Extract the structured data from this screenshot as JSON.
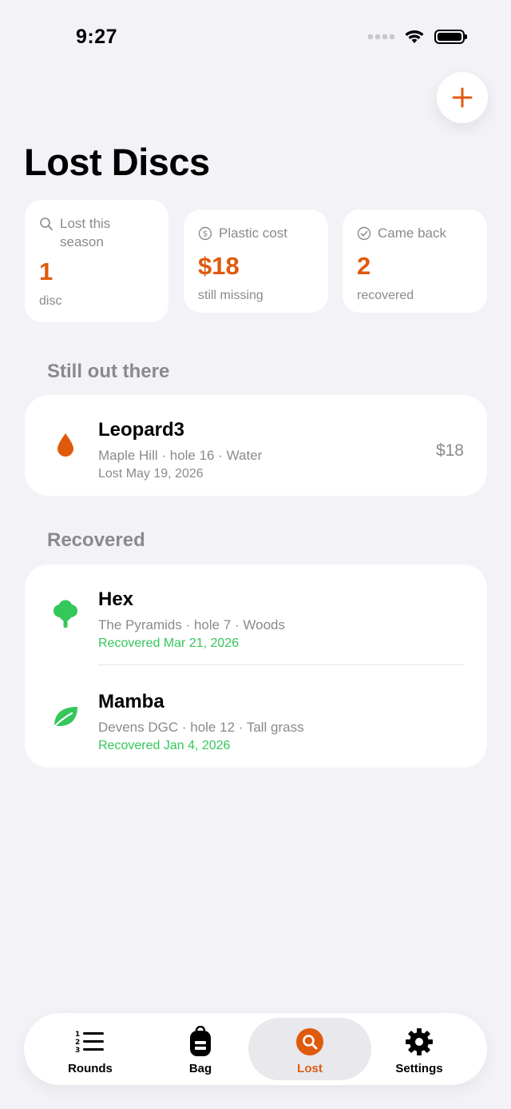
{
  "status_bar": {
    "time": "9:27"
  },
  "header": {
    "title": "Lost Discs"
  },
  "stats": [
    {
      "label": "Lost this season",
      "value": "1",
      "sub": "disc"
    },
    {
      "label": "Plastic cost",
      "value": "$18",
      "sub": "still missing"
    },
    {
      "label": "Came back",
      "value": "2",
      "sub": "recovered"
    }
  ],
  "still_out": {
    "title": "Still out there",
    "items": [
      {
        "name": "Leopard3",
        "meta": "Maple Hill · hole 16 · Water",
        "date": "Lost May 19, 2026",
        "price": "$18"
      }
    ]
  },
  "recovered": {
    "title": "Recovered",
    "items": [
      {
        "name": "Hex",
        "meta": "The Pyramids · hole 7 · Woods",
        "date": "Recovered Mar 21, 2026"
      },
      {
        "name": "Mamba",
        "meta": "Devens DGC · hole 12 · Tall grass",
        "date": "Recovered Jan 4, 2026"
      }
    ]
  },
  "tabs": [
    {
      "label": "Rounds",
      "icon": "numbered-list-icon"
    },
    {
      "label": "Bag",
      "icon": "backpack-icon"
    },
    {
      "label": "Lost",
      "icon": "search-icon"
    },
    {
      "label": "Settings",
      "icon": "gear-icon"
    }
  ],
  "colors": {
    "accent": "#e05a0c",
    "recovered": "#34c759",
    "secondary_text": "#8a8a8e",
    "background": "#f2f2f7"
  }
}
